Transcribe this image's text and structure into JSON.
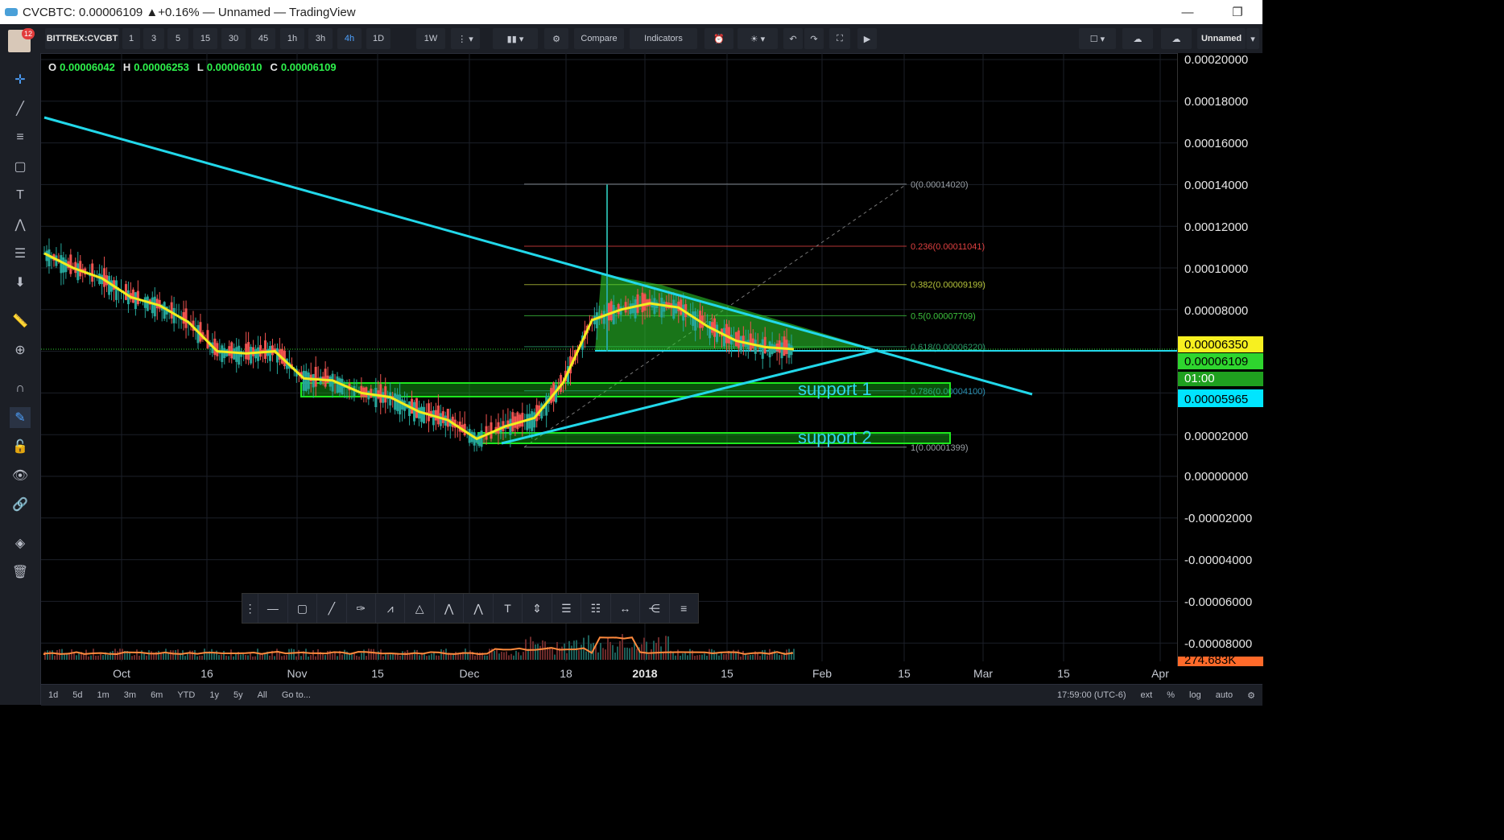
{
  "window": {
    "title": "CVCBTC: 0.00006109 ▲+0.16% — Unnamed — TradingView",
    "minimize": "—",
    "restore": "❐"
  },
  "account": {
    "badge": "12"
  },
  "toolbar": {
    "symbol": "BITTREX:CVCBT",
    "intervals": [
      "1",
      "3",
      "5",
      "15",
      "30",
      "45",
      "1h",
      "3h",
      "4h",
      "1D",
      "1W"
    ],
    "active_interval": "4h",
    "compare": "Compare",
    "indicators": "Indicators",
    "layout_name": "Unnamed"
  },
  "ohlc": {
    "o_label": "O",
    "o": "0.00006042",
    "h_label": "H",
    "h": "0.00006253",
    "l_label": "L",
    "l": "0.00006010",
    "c_label": "C",
    "c": "0.00006109"
  },
  "price_axis": {
    "ticks": [
      "0.00020000",
      "0.00018000",
      "0.00016000",
      "0.00014000",
      "0.00012000",
      "0.00010000",
      "0.00008000",
      "0.00002000",
      "0.00000000",
      "-0.00002000",
      "-0.00004000",
      "-0.00006000",
      "-0.00008000"
    ],
    "label_yellow": "0.00006350",
    "label_green": "0.00006109",
    "label_countdown": "01:00",
    "label_blue": "0.00005965",
    "label_volume": "274.683K"
  },
  "time_axis": [
    "Oct",
    "16",
    "Nov",
    "15",
    "Dec",
    "18",
    "2018",
    "15",
    "Feb",
    "15",
    "Mar",
    "15",
    "Apr"
  ],
  "fib_levels": [
    {
      "label": "0(0.00014020)",
      "color": "#9aa0a6"
    },
    {
      "label": "0.236(0.00011041)",
      "color": "#e04040"
    },
    {
      "label": "0.382(0.00009199)",
      "color": "#b5c23a"
    },
    {
      "label": "0.5(0.00007709)",
      "color": "#3ec43e"
    },
    {
      "label": "0.618(0.00006220)",
      "color": "#2a9d6a"
    },
    {
      "label": "0.786(0.00004100)",
      "color": "#2a8fb0"
    },
    {
      "label": "1(0.00001399)",
      "color": "#9aa0a6"
    }
  ],
  "annotations": [
    "support 1",
    "support 2"
  ],
  "bottombar": {
    "ranges": [
      "1d",
      "5d",
      "1m",
      "3m",
      "6m",
      "YTD",
      "1y",
      "5y",
      "All"
    ],
    "goto": "Go to...",
    "time": "17:59:00 (UTC-6)",
    "ext": "ext",
    "pct": "%",
    "log": "log",
    "auto": "auto"
  },
  "colors": {
    "trendline": "#22d8ea",
    "ema": "#f2ee1e",
    "zone": "#1ee81e",
    "fib_text": "#9aa0a6"
  },
  "chart_data": {
    "type": "line",
    "series": [
      {
        "values": [
          0.000107,
          0.0001,
          9.5e-05,
          8.6e-05,
          8.2e-05,
          7.4e-05,
          6e-05,
          5.9e-05,
          6e-05,
          4.7e-05,
          4.6e-05,
          4e-05,
          3.8e-05,
          3.1e-05,
          2.7e-05,
          1.8e-05,
          2.4e-05,
          2.8e-05,
          4.5e-05,
          7.5e-05,
          8e-05,
          8.3e-05,
          8.1e-05,
          7.2e-05,
          6.5e-05,
          6.2e-05,
          6.1e-05
        ]
      }
    ],
    "ylim": [
      -9e-05,
      0.0002
    ]
  }
}
